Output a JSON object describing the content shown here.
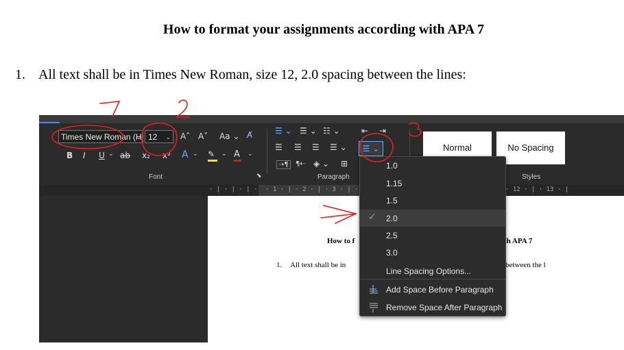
{
  "document": {
    "title": "How to format your assignments according with APA 7",
    "list_number": "1.",
    "item_text": "All text shall be in Times New Roman, size 12, 2.0 spacing between the lines:"
  },
  "ribbon": {
    "font_name": "Times New Roman (H",
    "font_size": "12",
    "font_group_label": "Font",
    "paragraph_group_label": "Paragraph",
    "styles_group_label": "Styles",
    "style_normal": "Normal",
    "style_no_spacing": "No Spacing",
    "grow_font": "A˄",
    "shrink_font": "A˅",
    "change_case": "Aa",
    "bold": "B",
    "italic": "I",
    "underline": "U",
    "strikethrough": "ab",
    "subscript": "x₂",
    "superscript": "x²"
  },
  "ruler": {
    "left_ticks": "· | · | · | ·",
    "center_ticks": "· 1 · | · 2 · | · 3 · | · 4 ·",
    "right_ticks": "· 12 · | · 13 · |"
  },
  "page_preview": {
    "heading_left": "How to f",
    "heading_right": "th APA 7",
    "line_number": "1.",
    "line_left": "All text shall be in",
    "line_right": "between the l"
  },
  "line_spacing_menu": {
    "options": [
      "1.0",
      "1.15",
      "1.5",
      "2.0",
      "2.5",
      "3.0"
    ],
    "selected": "2.0",
    "options_link": "Line Spacing Options...",
    "add_space_before": "Add Space Before Paragraph",
    "remove_space_after": "Remove Space After Paragraph"
  },
  "annotations": {
    "marks": [
      "1",
      "2",
      "3"
    ],
    "color": "#e02020"
  },
  "colors": {
    "ribbon_bg": "#2b2b2b",
    "menu_bg": "#2c2c2c",
    "check_green": "#6ec16e",
    "accent_blue": "#4b8df8"
  }
}
